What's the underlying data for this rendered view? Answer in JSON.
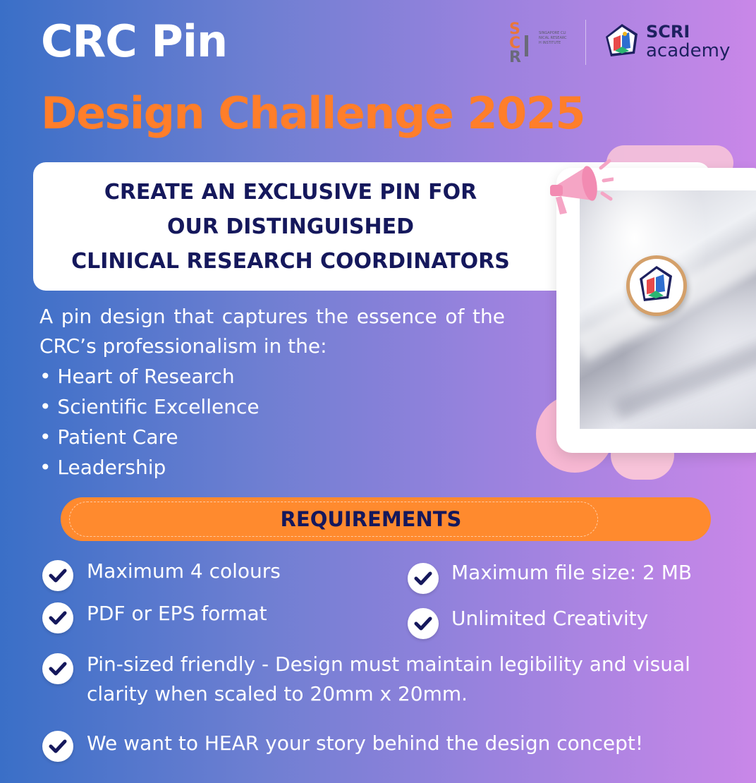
{
  "header": {
    "title_line1": "CRC Pin",
    "title_line2": "Design Challenge 2025"
  },
  "logos": {
    "sri_name": "SINGAPORE CLINICAL RESEARCH INSTITUTE",
    "academy_line1": "SCRI",
    "academy_line2": "academy"
  },
  "callout": {
    "line1": "CREATE AN EXCLUSIVE PIN FOR",
    "line2": "OUR DISTINGUISHED",
    "line3": "CLINICAL RESEARCH COORDINATORS"
  },
  "intro": {
    "text": "A pin design that captures the essence of the CRC’s professionalism in the:",
    "bullets": [
      "• Heart of Research",
      "• Scientific Excellence",
      "• Patient Care",
      "• Leadership"
    ]
  },
  "requirements": {
    "heading": "REQUIREMENTS",
    "items": [
      "Maximum 4 colours",
      "Maximum file size: 2 MB",
      "PDF or EPS format",
      "Unlimited Creativity",
      "Pin-sized friendly - Design must maintain legibility and visual clarity when scaled to 20mm x 20mm.",
      "We want to HEAR your story behind the design concept!"
    ]
  },
  "colors": {
    "accent_orange": "#ff7e2a",
    "navy": "#15185c",
    "gradient_start": "#3a6fc7",
    "gradient_end": "#c987e8"
  }
}
